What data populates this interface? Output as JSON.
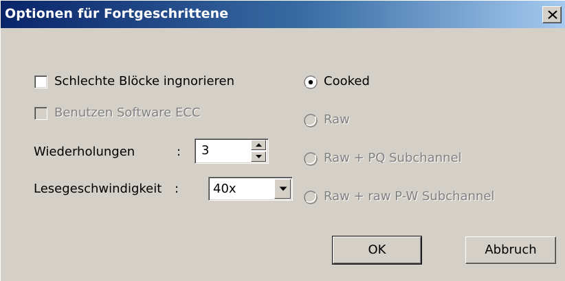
{
  "window": {
    "title": "Optionen für Fortgeschrittene",
    "close_icon": "close-x-icon"
  },
  "options": {
    "ignore_bad_blocks": {
      "label": "Schlechte Blöcke ingnorieren",
      "checked": false,
      "enabled": true
    },
    "software_ecc": {
      "label": "Benutzen Software ECC",
      "checked": false,
      "enabled": false
    },
    "retries": {
      "label": "Wiederholungen",
      "colon": ":",
      "value": "3"
    },
    "read_speed": {
      "label": "Lesegeschwindigkeit",
      "colon": ":",
      "value": "40x"
    }
  },
  "read_mode": {
    "options": [
      {
        "label": "Cooked",
        "selected": true,
        "enabled": true
      },
      {
        "label": "Raw",
        "selected": false,
        "enabled": false
      },
      {
        "label": "Raw + PQ Subchannel",
        "selected": false,
        "enabled": false
      },
      {
        "label": "Raw + raw P-W Subchannel",
        "selected": false,
        "enabled": false
      }
    ]
  },
  "buttons": {
    "ok": "OK",
    "cancel": "Abbruch"
  },
  "colors": {
    "title_gradient_start": "#0a246a",
    "title_gradient_end": "#a6caf0",
    "face": "#d4d0c8",
    "disabled_text": "#808080"
  }
}
